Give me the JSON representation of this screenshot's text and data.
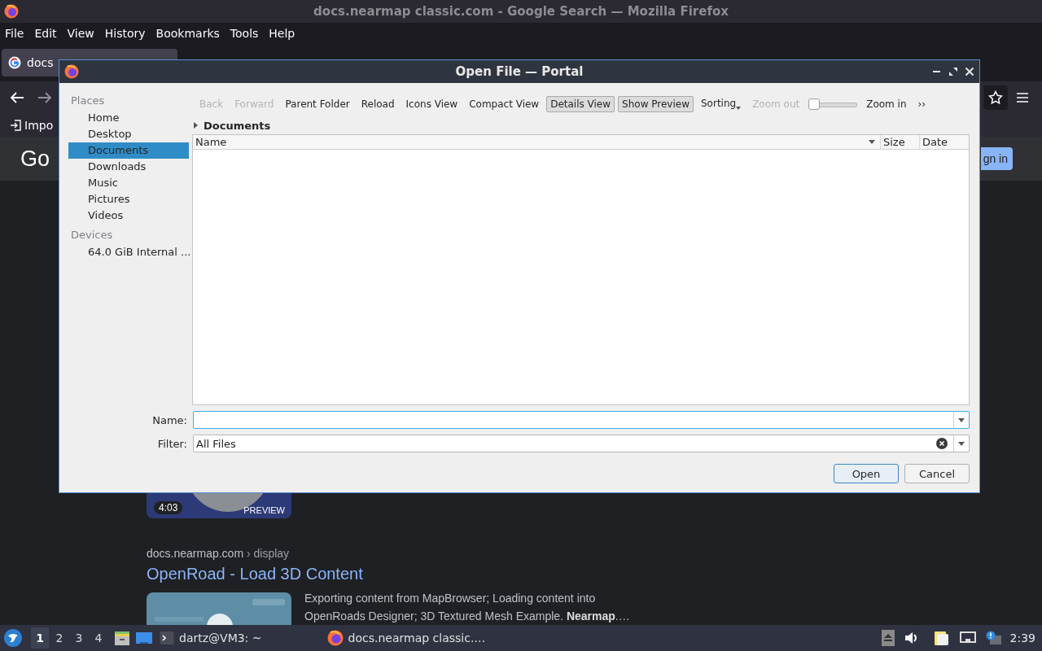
{
  "browser": {
    "title": "docs.nearmap classic.com - Google Search — Mozilla Firefox",
    "menu": [
      "File",
      "Edit",
      "View",
      "History",
      "Bookmarks",
      "Tools",
      "Help"
    ],
    "tab": {
      "label": "docs"
    },
    "bookmark": "Impo",
    "google": {
      "logo": "Go",
      "sign_in": "gn in"
    },
    "results": [
      {
        "kind": "video",
        "duration": "4:03",
        "badge": "PREVIEW"
      },
      {
        "kind": "page",
        "site": "docs.nearmap.com",
        "path": "› display",
        "title": "OpenRoad - Load 3D Content",
        "snippet": "Exporting content from MapBrowser; Loading content into OpenRoads Designer; 3D Textured Mesh Example. **Nearmap**.…"
      }
    ]
  },
  "dialog": {
    "title": "Open File — Portal",
    "places": [
      {
        "title": "Places",
        "items": [
          {
            "label": "Home",
            "selected": false
          },
          {
            "label": "Desktop",
            "selected": false
          },
          {
            "label": "Documents",
            "selected": true
          },
          {
            "label": "Downloads",
            "selected": false
          },
          {
            "label": "Music",
            "selected": false
          },
          {
            "label": "Pictures",
            "selected": false
          },
          {
            "label": "Videos",
            "selected": false
          }
        ]
      },
      {
        "title": "Devices",
        "items": [
          {
            "label": "64.0 GiB Internal ...",
            "selected": false
          }
        ]
      }
    ],
    "toolbar": [
      {
        "kind": "button",
        "label": "Back",
        "disabled": true,
        "checked": false
      },
      {
        "kind": "button",
        "label": "Forward",
        "disabled": true,
        "checked": false
      },
      {
        "kind": "button",
        "label": "Parent Folder",
        "disabled": false,
        "checked": false
      },
      {
        "kind": "button",
        "label": "Reload",
        "disabled": false,
        "checked": false
      },
      {
        "kind": "button",
        "label": "Icons View",
        "disabled": false,
        "checked": false
      },
      {
        "kind": "button",
        "label": "Compact View",
        "disabled": false,
        "checked": false
      },
      {
        "kind": "button",
        "label": "Details View",
        "disabled": false,
        "checked": true
      },
      {
        "kind": "button",
        "label": "Show Preview",
        "disabled": false,
        "checked": true
      },
      {
        "kind": "menu",
        "label": "Sorting",
        "disabled": false,
        "checked": false
      },
      {
        "kind": "button",
        "label": "Zoom out",
        "disabled": true,
        "checked": false
      },
      {
        "kind": "slider",
        "level": 0
      },
      {
        "kind": "button",
        "label": "Zoom in",
        "disabled": false,
        "checked": false
      },
      {
        "kind": "overflow",
        "label": "››"
      }
    ],
    "path": "Documents",
    "columns": [
      {
        "label": "Name",
        "sorted": true
      },
      {
        "label": "Size",
        "sorted": false
      },
      {
        "label": "Date",
        "sorted": false
      }
    ],
    "name_field": {
      "label": "Name:",
      "focused": true
    },
    "filter_field": {
      "label": "Filter:",
      "value": "All Files"
    },
    "buttons": [
      {
        "label": "Open",
        "default": true
      },
      {
        "label": "Cancel",
        "default": false
      }
    ]
  },
  "taskbar": {
    "workspaces": [
      {
        "label": "1",
        "selected": true
      },
      {
        "label": "2",
        "selected": false
      },
      {
        "label": "3",
        "selected": false
      },
      {
        "label": "4",
        "selected": false
      }
    ],
    "tasks": [
      {
        "kind": "terminal",
        "label": "dartz@VM3: ~"
      },
      {
        "kind": "browser",
        "label": "docs.nearmap classic.…"
      }
    ],
    "clock": "2:39"
  }
}
